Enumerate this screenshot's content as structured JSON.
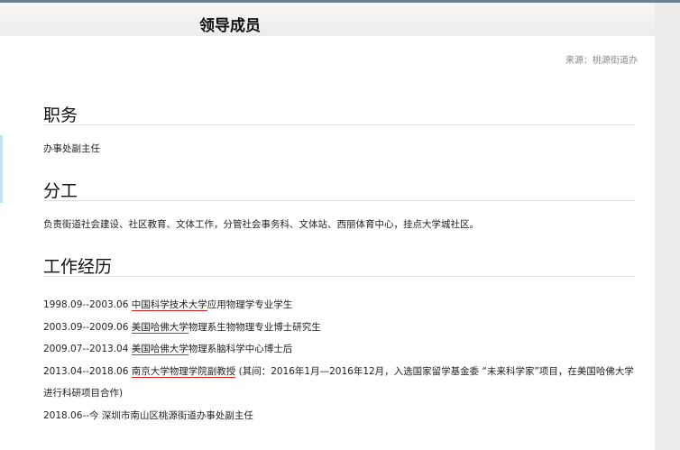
{
  "header": {
    "title": "领导成员"
  },
  "source": "来源：桃源街道办",
  "sections": {
    "duty": {
      "heading": "职务",
      "text": "办事处副主任"
    },
    "division": {
      "heading": "分工",
      "text": "负责街道社会建设、社区教育、文体工作，分管社会事务科、文体站、西丽体育中心，挂点大学城社区。"
    },
    "history": {
      "heading": "工作经历",
      "items": [
        {
          "date": "1998.09--2003.06 ",
          "underlined": "中国科学技术大学",
          "rest": "应用物理学专业学生"
        },
        {
          "date": "2003.09--2009.06 ",
          "underlined": "美国哈佛大学",
          "rest": "物理系生物物理专业博士研究生"
        },
        {
          "date": "2009.07--2013.04 ",
          "underlined": "美国哈佛大学",
          "rest": "物理系脑科学中心博士后"
        },
        {
          "date": "2013.04--2018.06 ",
          "underlined": "南京大学物理学院副教授",
          "rest": " (其间：2016年1月—2016年12月，入选国家留学基金委 “未来科学家”项目，在美国哈佛大学进行科研项目合作)"
        },
        {
          "date": "2018.06--今 ",
          "underlined": "",
          "rest": "深圳市南山区桃源街道办事处副主任"
        }
      ]
    }
  }
}
